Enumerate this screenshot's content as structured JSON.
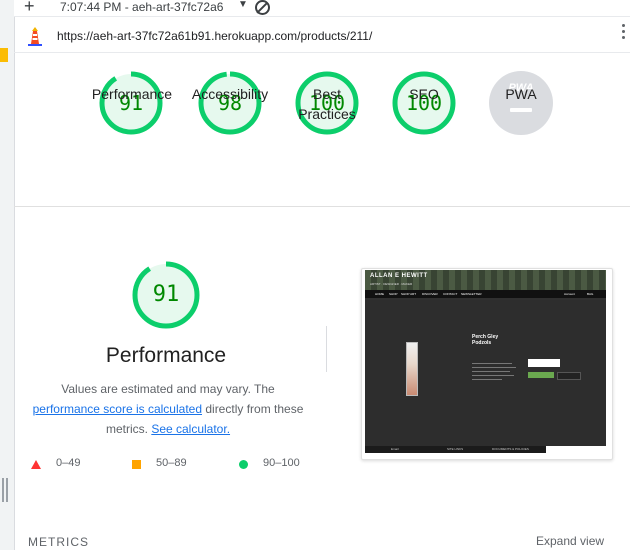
{
  "browser": {
    "tab_title": "7:07:44 PM - aeh-art-37fc72a6",
    "url": "https://aeh-art-37fc72a61b91.herokuapp.com/products/211/"
  },
  "categories": [
    {
      "score": "91",
      "label": "Performance",
      "fraction": 0.91
    },
    {
      "score": "98",
      "label": "Accessibility",
      "fraction": 0.98
    },
    {
      "score": "100",
      "label": "Best Practices",
      "fraction": 1.0
    },
    {
      "score": "100",
      "label": "SEO",
      "fraction": 1.0
    },
    {
      "score": "PWA",
      "label": "PWA"
    }
  ],
  "performance": {
    "score": "91",
    "fraction": 0.91,
    "title": "Performance",
    "desc_prefix": "Values are estimated and may vary. The ",
    "desc_link1": "performance score is calculated",
    "desc_mid": " directly from these metrics. ",
    "desc_link2": "See calculator."
  },
  "legend": {
    "fail": "0–49",
    "average": "50–89",
    "pass": "90–100"
  },
  "screenshot": {
    "brand": "ALLAN E HEWITT",
    "tagline": "ARTIST · DESIGNER · MAKER",
    "nav_items": [
      "HOME",
      "SHOP",
      "SHOP ART",
      "DISCOVER",
      "CONTACT",
      "NEWSLETTER"
    ],
    "account": "Account",
    "bag": "BAG",
    "product_title": "Perch Gley Podzols",
    "footer_items": [
      "Email",
      "SITE LINKS",
      "DOCUMENTS & POLICIES"
    ]
  },
  "metrics_heading": "METRICS",
  "expand_view": "Expand view",
  "colors": {
    "pass": "#0cce6b",
    "pass_text": "#008800",
    "pass_bg": "#e6f9ee",
    "average": "#ffa400",
    "fail": "#ff3333",
    "link": "#1a73e8",
    "pwa_gray": "#dadce0"
  }
}
